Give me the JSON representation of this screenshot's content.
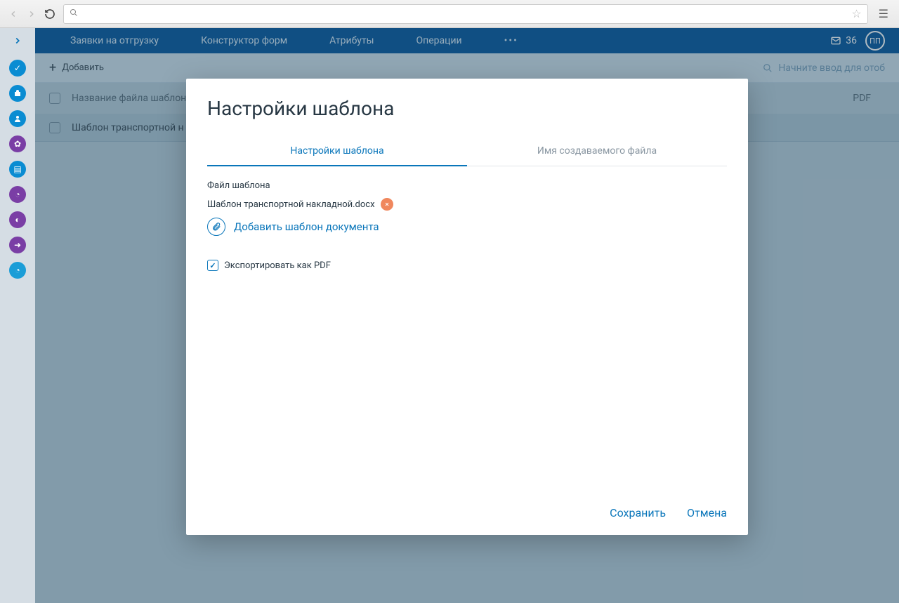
{
  "topnav": {
    "tabs": [
      "Заявки на отгрузку",
      "Конструктор форм",
      "Атрибуты",
      "Операции"
    ],
    "mail_count": "36",
    "avatar": "ПП"
  },
  "toolbar": {
    "add": "Добавить",
    "search_placeholder": "Начните ввод для отоб"
  },
  "table": {
    "header_name": "Название файла шаблон",
    "header_pdf": "PDF",
    "row1": "Шаблон транспортной н"
  },
  "modal": {
    "title": "Настройки шаблона",
    "tab1": "Настройки шаблона",
    "tab2": "Имя создаваемого файла",
    "file_label": "Файл шаблона",
    "file_name": "Шаблон транспортной накладной.docx",
    "add_template": "Добавить шаблон документа",
    "export_pdf": "Экспортировать как PDF",
    "save": "Сохранить",
    "cancel": "Отмена"
  }
}
